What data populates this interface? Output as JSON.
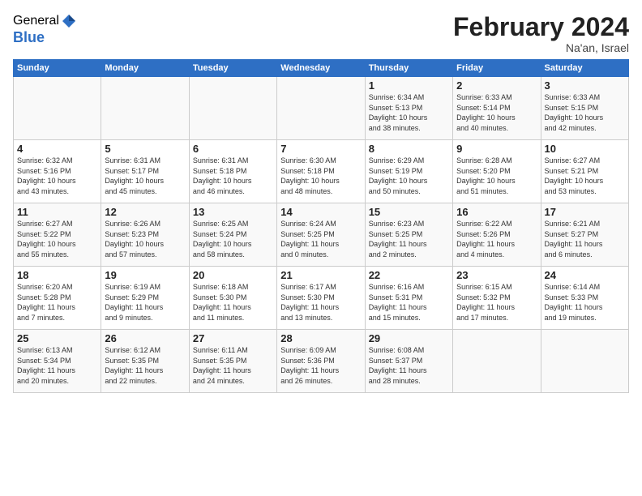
{
  "logo": {
    "general": "General",
    "blue": "Blue"
  },
  "title": "February 2024",
  "location": "Na'an, Israel",
  "days_of_week": [
    "Sunday",
    "Monday",
    "Tuesday",
    "Wednesday",
    "Thursday",
    "Friday",
    "Saturday"
  ],
  "weeks": [
    [
      {
        "day": "",
        "info": ""
      },
      {
        "day": "",
        "info": ""
      },
      {
        "day": "",
        "info": ""
      },
      {
        "day": "",
        "info": ""
      },
      {
        "day": "1",
        "info": "Sunrise: 6:34 AM\nSunset: 5:13 PM\nDaylight: 10 hours\nand 38 minutes."
      },
      {
        "day": "2",
        "info": "Sunrise: 6:33 AM\nSunset: 5:14 PM\nDaylight: 10 hours\nand 40 minutes."
      },
      {
        "day": "3",
        "info": "Sunrise: 6:33 AM\nSunset: 5:15 PM\nDaylight: 10 hours\nand 42 minutes."
      }
    ],
    [
      {
        "day": "4",
        "info": "Sunrise: 6:32 AM\nSunset: 5:16 PM\nDaylight: 10 hours\nand 43 minutes."
      },
      {
        "day": "5",
        "info": "Sunrise: 6:31 AM\nSunset: 5:17 PM\nDaylight: 10 hours\nand 45 minutes."
      },
      {
        "day": "6",
        "info": "Sunrise: 6:31 AM\nSunset: 5:18 PM\nDaylight: 10 hours\nand 46 minutes."
      },
      {
        "day": "7",
        "info": "Sunrise: 6:30 AM\nSunset: 5:18 PM\nDaylight: 10 hours\nand 48 minutes."
      },
      {
        "day": "8",
        "info": "Sunrise: 6:29 AM\nSunset: 5:19 PM\nDaylight: 10 hours\nand 50 minutes."
      },
      {
        "day": "9",
        "info": "Sunrise: 6:28 AM\nSunset: 5:20 PM\nDaylight: 10 hours\nand 51 minutes."
      },
      {
        "day": "10",
        "info": "Sunrise: 6:27 AM\nSunset: 5:21 PM\nDaylight: 10 hours\nand 53 minutes."
      }
    ],
    [
      {
        "day": "11",
        "info": "Sunrise: 6:27 AM\nSunset: 5:22 PM\nDaylight: 10 hours\nand 55 minutes."
      },
      {
        "day": "12",
        "info": "Sunrise: 6:26 AM\nSunset: 5:23 PM\nDaylight: 10 hours\nand 57 minutes."
      },
      {
        "day": "13",
        "info": "Sunrise: 6:25 AM\nSunset: 5:24 PM\nDaylight: 10 hours\nand 58 minutes."
      },
      {
        "day": "14",
        "info": "Sunrise: 6:24 AM\nSunset: 5:25 PM\nDaylight: 11 hours\nand 0 minutes."
      },
      {
        "day": "15",
        "info": "Sunrise: 6:23 AM\nSunset: 5:25 PM\nDaylight: 11 hours\nand 2 minutes."
      },
      {
        "day": "16",
        "info": "Sunrise: 6:22 AM\nSunset: 5:26 PM\nDaylight: 11 hours\nand 4 minutes."
      },
      {
        "day": "17",
        "info": "Sunrise: 6:21 AM\nSunset: 5:27 PM\nDaylight: 11 hours\nand 6 minutes."
      }
    ],
    [
      {
        "day": "18",
        "info": "Sunrise: 6:20 AM\nSunset: 5:28 PM\nDaylight: 11 hours\nand 7 minutes."
      },
      {
        "day": "19",
        "info": "Sunrise: 6:19 AM\nSunset: 5:29 PM\nDaylight: 11 hours\nand 9 minutes."
      },
      {
        "day": "20",
        "info": "Sunrise: 6:18 AM\nSunset: 5:30 PM\nDaylight: 11 hours\nand 11 minutes."
      },
      {
        "day": "21",
        "info": "Sunrise: 6:17 AM\nSunset: 5:30 PM\nDaylight: 11 hours\nand 13 minutes."
      },
      {
        "day": "22",
        "info": "Sunrise: 6:16 AM\nSunset: 5:31 PM\nDaylight: 11 hours\nand 15 minutes."
      },
      {
        "day": "23",
        "info": "Sunrise: 6:15 AM\nSunset: 5:32 PM\nDaylight: 11 hours\nand 17 minutes."
      },
      {
        "day": "24",
        "info": "Sunrise: 6:14 AM\nSunset: 5:33 PM\nDaylight: 11 hours\nand 19 minutes."
      }
    ],
    [
      {
        "day": "25",
        "info": "Sunrise: 6:13 AM\nSunset: 5:34 PM\nDaylight: 11 hours\nand 20 minutes."
      },
      {
        "day": "26",
        "info": "Sunrise: 6:12 AM\nSunset: 5:35 PM\nDaylight: 11 hours\nand 22 minutes."
      },
      {
        "day": "27",
        "info": "Sunrise: 6:11 AM\nSunset: 5:35 PM\nDaylight: 11 hours\nand 24 minutes."
      },
      {
        "day": "28",
        "info": "Sunrise: 6:09 AM\nSunset: 5:36 PM\nDaylight: 11 hours\nand 26 minutes."
      },
      {
        "day": "29",
        "info": "Sunrise: 6:08 AM\nSunset: 5:37 PM\nDaylight: 11 hours\nand 28 minutes."
      },
      {
        "day": "",
        "info": ""
      },
      {
        "day": "",
        "info": ""
      }
    ]
  ]
}
